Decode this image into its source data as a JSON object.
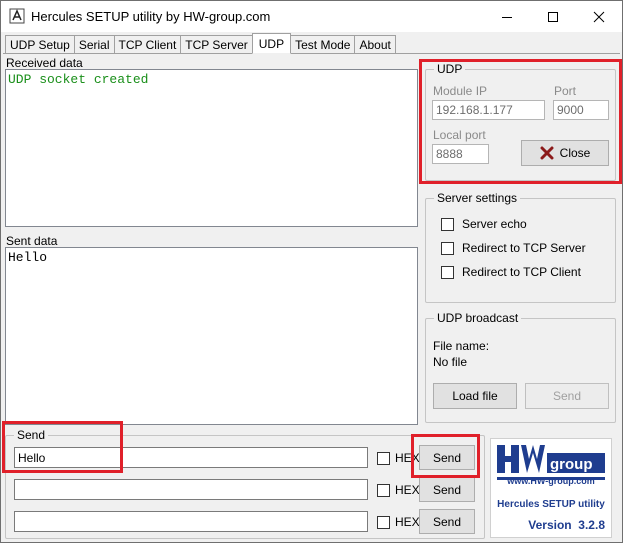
{
  "window": {
    "title": "Hercules SETUP utility by HW-group.com",
    "minimize_icon": "minimize-icon",
    "maximize_icon": "maximize-icon",
    "close_icon": "close-icon"
  },
  "tabs": [
    {
      "label": "UDP Setup"
    },
    {
      "label": "Serial"
    },
    {
      "label": "TCP Client"
    },
    {
      "label": "TCP Server"
    },
    {
      "label": "UDP",
      "active": true
    },
    {
      "label": "Test Mode"
    },
    {
      "label": "About"
    }
  ],
  "received": {
    "label": "Received data",
    "text": "UDP socket created",
    "text_color": "#1a8f1a"
  },
  "sent": {
    "label": "Sent data",
    "text": "Hello"
  },
  "udp": {
    "group_label": "UDP",
    "module_ip_label": "Module IP",
    "module_ip_value": "192.168.1.177",
    "port_label": "Port",
    "port_value": "9000",
    "local_port_label": "Local port",
    "local_port_value": "8888",
    "close_button_label": "Close",
    "close_icon": "x-icon",
    "close_icon_color": "#8b1a1a"
  },
  "server_settings": {
    "group_label": "Server settings",
    "options": [
      {
        "label": "Server echo",
        "checked": false
      },
      {
        "label": "Redirect to TCP Server",
        "checked": false
      },
      {
        "label": "Redirect to TCP Client",
        "checked": false
      }
    ]
  },
  "udp_broadcast": {
    "group_label": "UDP broadcast",
    "file_name_label": "File name:",
    "file_name_value": "No file",
    "load_file_label": "Load file",
    "send_label": "Send"
  },
  "send": {
    "group_label": "Send",
    "rows": [
      {
        "value": "Hello",
        "hex_label": "HEX",
        "button_label": "Send"
      },
      {
        "value": "",
        "hex_label": "HEX",
        "button_label": "Send"
      },
      {
        "value": "",
        "hex_label": "HEX",
        "button_label": "Send"
      }
    ]
  },
  "logo": {
    "brand": "HW group",
    "brand_hw": "HW",
    "brand_group": "group",
    "url": "www.HW-group.com",
    "product": "Hercules SETUP utility",
    "version": "Version  3.2.8",
    "brand_color": "#1f3d8f"
  },
  "highlights": {
    "color": "#e0202a"
  }
}
